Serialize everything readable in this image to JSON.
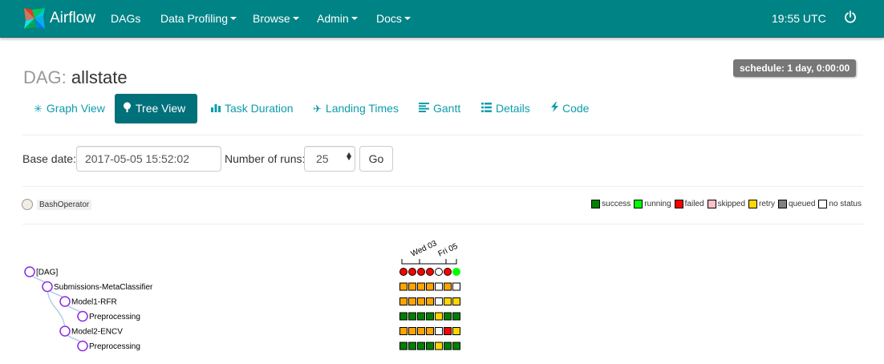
{
  "navbar": {
    "brand": "Airflow",
    "items": [
      {
        "label": "DAGs",
        "dropdown": false
      },
      {
        "label": "Data Profiling",
        "dropdown": true
      },
      {
        "label": "Browse",
        "dropdown": true
      },
      {
        "label": "Admin",
        "dropdown": true
      },
      {
        "label": "Docs",
        "dropdown": true
      }
    ],
    "time": "19:55 UTC",
    "logout_icon": "power-icon"
  },
  "header": {
    "prefix": "DAG:",
    "dag_id": "allstate",
    "schedule": "schedule: 1 day, 0:00:00"
  },
  "tabs": [
    {
      "label": "Graph View",
      "icon": "asterisk-icon",
      "active": false
    },
    {
      "label": "Tree View",
      "icon": "tree-icon",
      "active": true
    },
    {
      "label": "Task Duration",
      "icon": "bar-chart-icon",
      "active": false
    },
    {
      "label": "Landing Times",
      "icon": "plane-icon",
      "active": false
    },
    {
      "label": "Gantt",
      "icon": "align-left-icon",
      "active": false
    },
    {
      "label": "Details",
      "icon": "list-icon",
      "active": false
    },
    {
      "label": "Code",
      "icon": "flash-icon",
      "active": false
    }
  ],
  "form": {
    "base_date_label": "Base date:",
    "base_date_value": "2017-05-05 15:52:02",
    "num_runs_label": "Number of runs:",
    "num_runs_value": "25",
    "go_label": "Go"
  },
  "legend": {
    "operator": "BashOperator",
    "operator_color": "#f0ede4",
    "statuses": [
      {
        "label": "success",
        "color": "#008000"
      },
      {
        "label": "running",
        "color": "#00ff00"
      },
      {
        "label": "failed",
        "color": "#ff0000"
      },
      {
        "label": "skipped",
        "color": "#ffc0cb"
      },
      {
        "label": "retry",
        "color": "#ffd700"
      },
      {
        "label": "queued",
        "color": "#808080"
      },
      {
        "label": "no status",
        "color": "#ffffff"
      }
    ]
  },
  "tree": {
    "dates": [
      "Wed 03",
      "Fri 05"
    ],
    "nodes": [
      {
        "label": "[DAG]",
        "depth": 0,
        "runs": [
          "failed",
          "failed",
          "failed",
          "failed",
          "none",
          "failed",
          "running"
        ],
        "is_dag": true
      },
      {
        "label": "Submissions-MetaClassifier",
        "depth": 1,
        "runs": [
          "upstream_failed",
          "upstream_failed",
          "upstream_failed",
          "upstream_failed",
          "none",
          "upstream_failed",
          "none"
        ]
      },
      {
        "label": "Model1-RFR",
        "depth": 2,
        "runs": [
          "upstream_failed",
          "upstream_failed",
          "upstream_failed",
          "upstream_failed",
          "none",
          "retry",
          "retry"
        ]
      },
      {
        "label": "Preprocessing",
        "depth": 3,
        "runs": [
          "success",
          "success",
          "success",
          "success",
          "retry",
          "success",
          "success"
        ]
      },
      {
        "label": "Model2-ENCV",
        "depth": 2,
        "runs": [
          "upstream_failed",
          "upstream_failed",
          "upstream_failed",
          "upstream_failed",
          "none",
          "failed",
          "retry"
        ]
      },
      {
        "label": "Preprocessing",
        "depth": 3,
        "runs": [
          "success",
          "success",
          "success",
          "success",
          "retry",
          "success",
          "success"
        ]
      }
    ],
    "state_colors": {
      "success": "#008000",
      "running": "#00ff00",
      "failed": "#ff0000",
      "upstream_failed": "#ffa500",
      "retry": "#ffd700",
      "none": "#ffffff"
    }
  }
}
